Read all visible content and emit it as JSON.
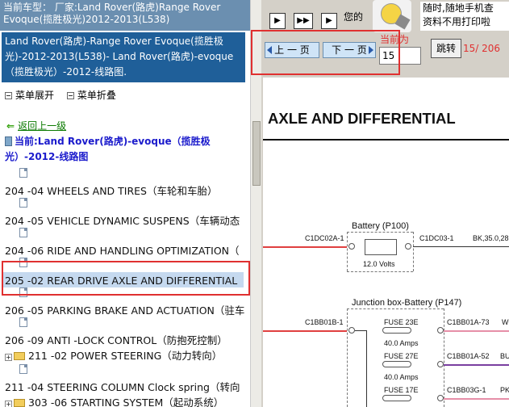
{
  "left_panel": {
    "header": "当前车型： 厂家:Land Rover(路虎)Range Rover Evoque(揽胜极光)2012-2013(L538)",
    "model_title": "Land Rover(路虎)-Range Rover Evoque(揽胜极光)-2012-2013(L538)- Land Rover(路虎)-evoque（揽胜极光）-2012-线路图.",
    "expand_all": "菜单展开",
    "collapse_all": "菜单折叠",
    "back_link": "返回上一级",
    "current_label": "当前:Land Rover(路虎)-evoque（揽胜极光）-2012-线路图",
    "tree_items": [
      {
        "label": "204 -04 WHEELS AND TIRES（车轮和车胎）"
      },
      {
        "label": "204 -05 VEHICLE DYNAMIC SUSPENS（车辆动态"
      },
      {
        "label": "204 -06 RIDE AND HANDLING OPTIMIZATION（"
      },
      {
        "label": "205 -02 REAR DRIVE AXLE AND DIFFERENTIAL（"
      },
      {
        "label": "206 -05 PARKING BRAKE AND ACTUATION（驻车"
      },
      {
        "label": "206 -09 ANTI -LOCK CONTROL（防抱死控制）"
      }
    ],
    "folder_items": [
      {
        "label": "211 -02 POWER STEERING（动力转向）"
      },
      {
        "label": "303 -06 STARTING SYSTEM（起动系统）"
      }
    ],
    "extra_item": "211 -04 STEERING COLUMN Clock spring（转向"
  },
  "right_panel": {
    "nav_buttons": [
      "▶",
      "▶▶",
      "▶"
    ],
    "ad_text": "您的",
    "ad_right_line1": "随时,随地手机查",
    "ad_right_line2": "资料不用打印啦",
    "prev_label": "上 一 页",
    "next_label": "下 一 页",
    "page_label": "当前为",
    "page_value": "15",
    "jump_label": "跳转",
    "page_count": "15/ 206",
    "doc_title": "AXLE AND DIFFERENTIAL",
    "diagram": {
      "battery_title": "Battery (P100)",
      "batt_left_conn": "C1DC02A-1",
      "batt_right_conn": "C1DC03-1",
      "batt_right_wire": "BK,35.0,28",
      "batt_volts": "12.0 Volts",
      "junction_title": "Junction box-Battery (P147)",
      "jb_left_conn": "C1BB01B-1",
      "fuse1": "FUSE 23E",
      "fuse1_amps": "40.0 Amps",
      "fuse1_conn": "C1BB01A-73",
      "fuse1_wire": "W",
      "fuse2": "FUSE 27E",
      "fuse2_amps": "40.0 Amps",
      "fuse2_conn": "C1BB01A-52",
      "fuse2_wire": "BU",
      "fuse3": "FUSE 17E",
      "fuse3_conn": "C1BB03G-1",
      "fuse3_wire": "PK"
    }
  },
  "colors": {
    "header_bg": "#6b8fb0",
    "model_bg": "#1f5f99",
    "highlight": "#e03030",
    "wire_red": "#e04040"
  }
}
